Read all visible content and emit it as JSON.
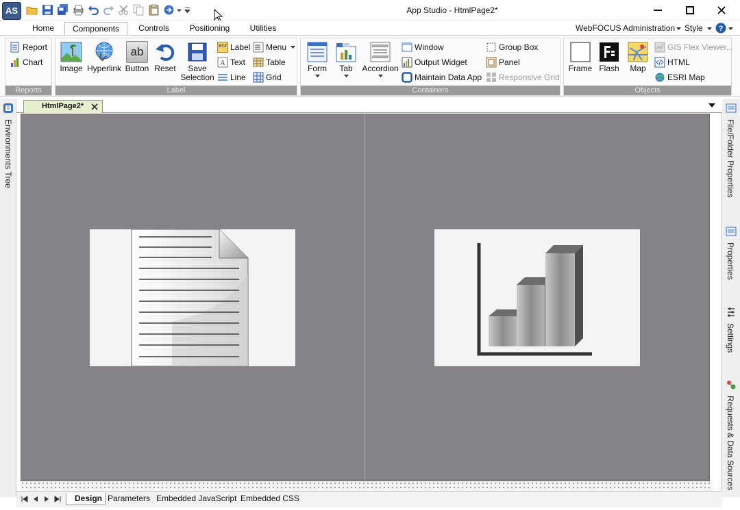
{
  "titlebar": {
    "app_logo": "AS",
    "window_title": "App Studio - HtmlPage2*",
    "quick_access": [
      "open-folder-icon",
      "save-icon",
      "save-all-icon",
      "print-icon",
      "undo-icon",
      "redo-icon",
      "cut-icon",
      "copy-icon",
      "paste-icon",
      "run-icon",
      "dropdown-icon",
      "customize-icon"
    ]
  },
  "ribbon_tabs": [
    "Home",
    "Components",
    "Controls",
    "Positioning",
    "Utilities"
  ],
  "active_tab": "Components",
  "right_menu": {
    "admin": "WebFOCUS Administration",
    "style": "Style"
  },
  "groups": {
    "reports": {
      "label": "Reports",
      "items": {
        "report": "Report",
        "chart": "Chart"
      }
    },
    "generic": {
      "label": "Label",
      "image": "Image",
      "hyperlink": "Hyperlink",
      "button": "Button",
      "button_glyph": "ab",
      "reset": "Reset",
      "save_selection_line1": "Save",
      "save_selection_line2": "Selection",
      "label_glyph": "XYZ",
      "text": "Text",
      "line": "Line",
      "menu": "Menu",
      "table": "Table",
      "grid": "Grid"
    },
    "containers": {
      "label": "Containers",
      "form": "Form",
      "tab": "Tab",
      "accordion": "Accordion",
      "window": "Window",
      "output_widget": "Output Widget",
      "maintain_data_app": "Maintain Data App",
      "group_box": "Group Box",
      "panel": "Panel",
      "responsive_grid": "Responsive Grid"
    },
    "objects": {
      "label": "Objects",
      "frame": "Frame",
      "flash": "Flash",
      "map": "Map",
      "gis_flex_viewer": "GIS Flex Viewer...",
      "html": "HTML",
      "esri_map": "ESRI Map"
    }
  },
  "document_tab": {
    "label": "HtmlPage2*"
  },
  "side_panels": {
    "left": "Environments Tree",
    "right": [
      "File/Folder Properties",
      "Properties",
      "Settings",
      "Requests & Data Sources"
    ]
  },
  "canvas": {
    "background": "#858387",
    "elements": [
      {
        "name": "report-placeholder",
        "icon": "report-document-icon"
      },
      {
        "name": "chart-placeholder",
        "icon": "bar-chart-icon"
      }
    ]
  },
  "bottom_tabs": [
    "Design",
    "Parameters",
    "Embedded JavaScript",
    "Embedded CSS"
  ],
  "active_bottom_tab": "Design",
  "colors": {
    "accent": "#1e5aa8",
    "group_label_bg": "#9a9a9a",
    "doc_tab_bg": "#e6efcf",
    "canvas_bg": "#858387"
  }
}
